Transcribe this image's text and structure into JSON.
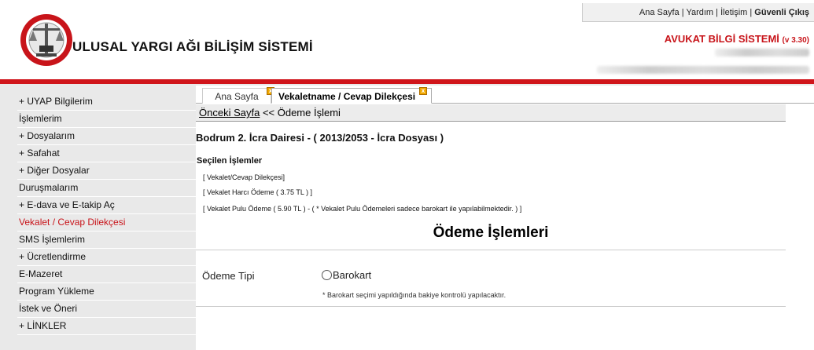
{
  "header": {
    "top_links": [
      "Ana Sayfa",
      "Yardım",
      "İletişim",
      "Güvenli Çıkış"
    ],
    "site_title": "ULUSAL YARGI AĞI BİLİŞİM SİSTEMİ",
    "system_title": "AVUKAT BİLGİ SİSTEMİ",
    "version": "(v 3.30)"
  },
  "sidebar": {
    "items": [
      {
        "label": "+ UYAP Bilgilerim"
      },
      {
        "label": "İşlemlerim"
      },
      {
        "label": "+ Dosyalarım"
      },
      {
        "label": "+ Safahat"
      },
      {
        "label": "+ Diğer Dosyalar"
      },
      {
        "label": "Duruşmalarım"
      },
      {
        "label": "+ E-dava ve E-takip Aç"
      },
      {
        "label": "Vekalet / Cevap Dilekçesi"
      },
      {
        "label": "SMS İşlemlerim"
      },
      {
        "label": "+ Ücretlendirme"
      },
      {
        "label": "E-Mazeret"
      },
      {
        "label": "Program Yükleme"
      },
      {
        "label": "İstek ve Öneri"
      },
      {
        "label": "+ LİNKLER"
      }
    ]
  },
  "tabs": [
    {
      "label": "Ana Sayfa"
    },
    {
      "label": "Vekaletname / Cevap Dilekçesi"
    }
  ],
  "breadcrumb": {
    "link": "Önceki Sayfa",
    "current": " << Ödeme İşlemi"
  },
  "main": {
    "court": "Bodrum 2. İcra Dairesi - ( 2013/2053 - İcra Dosyası )",
    "selected_title": "Seçilen İşlemler",
    "selected_items": [
      "[ Vekalet/Cevap Dilekçesi]",
      "[ Vekalet Harcı Ödeme ( 3.75 TL ) ]",
      "[ Vekalet Pulu Ödeme ( 5.90 TL ) - ( * Vekalet Pulu Ödemeleri sadece barokart ile yapılabilmektedir. ) ]"
    ],
    "payment_title": "Ödeme İşlemleri",
    "payment_type_label": "Ödeme Tipi",
    "payment_option": "Barokart",
    "note": "* Barokart seçimi yapıldığında bakiye kontrolü yapılacaktır."
  },
  "colors": {
    "brand_red": "#c8141a",
    "sidebar_bg": "#e9e9e9"
  }
}
